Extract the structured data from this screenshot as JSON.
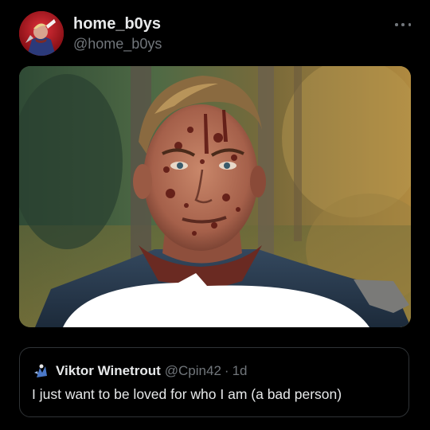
{
  "post": {
    "display_name": "home_b0ys",
    "handle": "@home_b0ys",
    "avatar_icon": "avatar-red-superhero",
    "more_icon": "more-dots-icon",
    "media_description": "photo"
  },
  "quoted_post": {
    "display_name": "Viktor Winetrout",
    "handle": "@Cpin42",
    "separator": "·",
    "time": "1d",
    "text": "I just want to be loved for who I am (a bad person)"
  },
  "colors": {
    "background": "#000000",
    "primary_text": "#e7e9ea",
    "secondary_text": "#71767b",
    "border": "#2f3336",
    "avatar_red": "#b3121b"
  }
}
